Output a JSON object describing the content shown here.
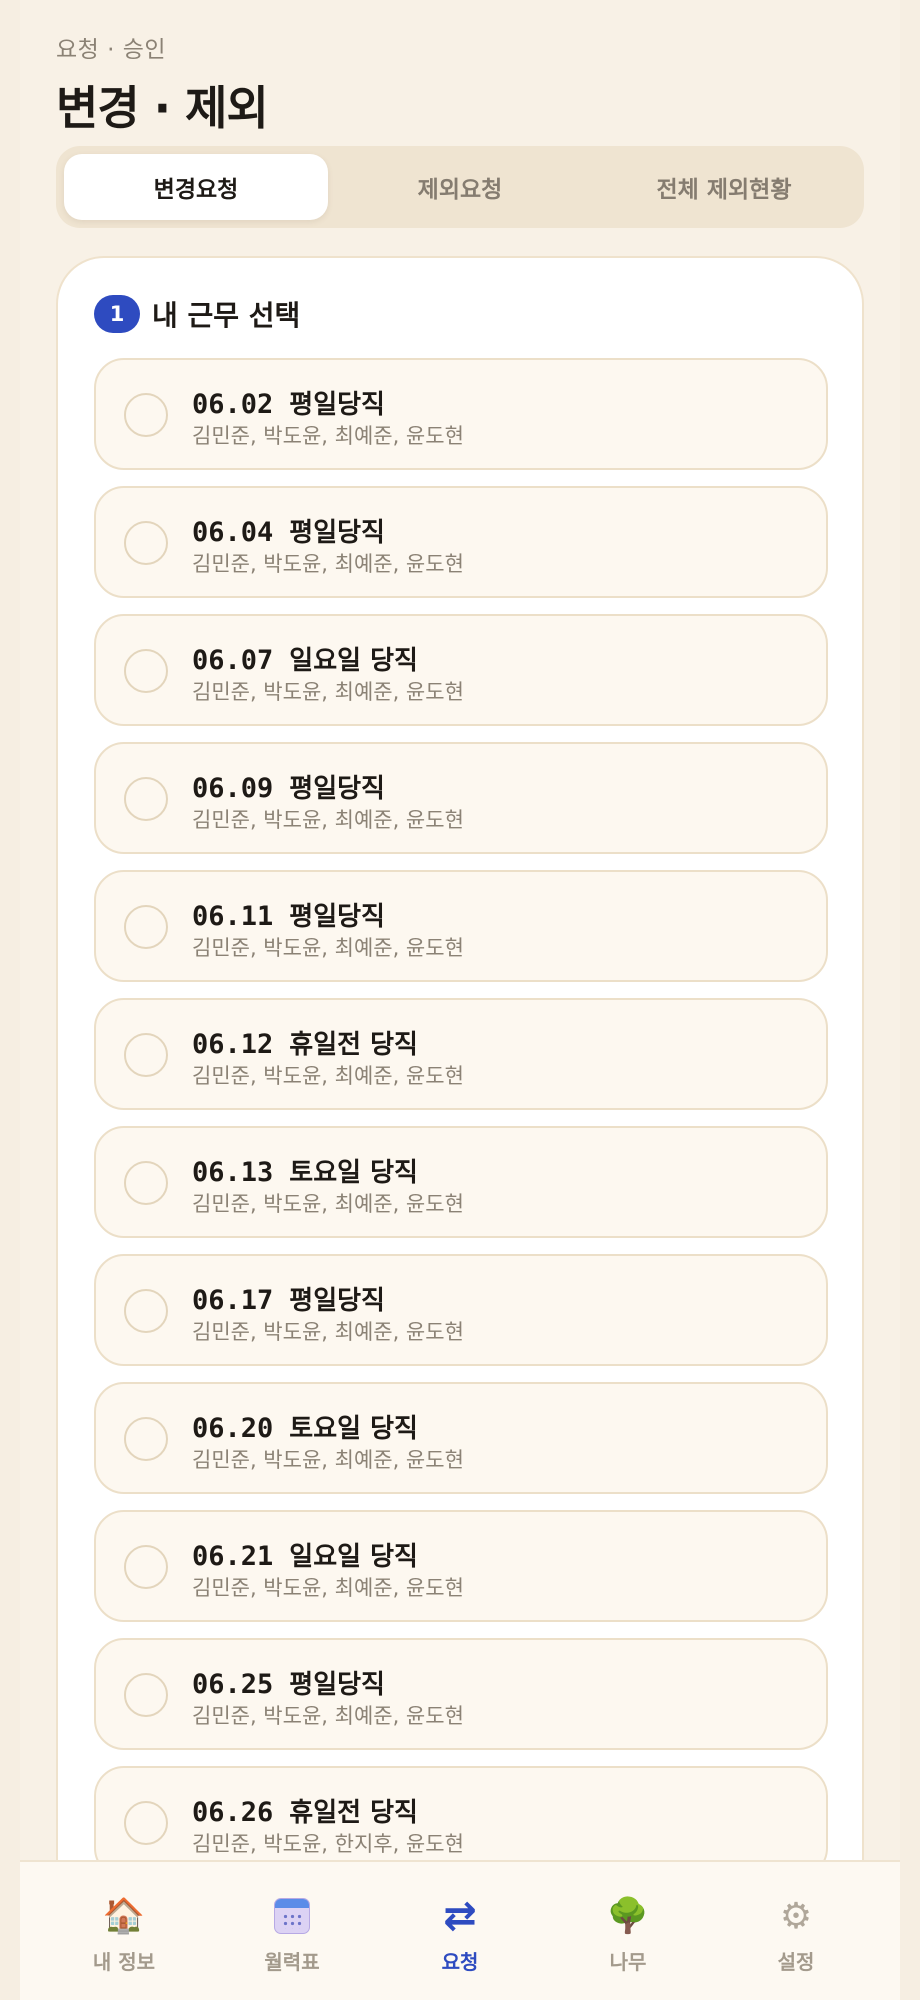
{
  "header": {
    "subtitle": "요청 · 승인",
    "title": "변경 · 제외"
  },
  "tabs": [
    {
      "label": "변경요청",
      "active": true
    },
    {
      "label": "제외요청",
      "active": false
    },
    {
      "label": "전체 제외현황",
      "active": false
    }
  ],
  "section": {
    "step": "1",
    "title": "내 근무 선택"
  },
  "shifts": [
    {
      "date": "06.02",
      "type": "평일당직",
      "members": "김민준, 박도윤, 최예준, 윤도현"
    },
    {
      "date": "06.04",
      "type": "평일당직",
      "members": "김민준, 박도윤, 최예준, 윤도현"
    },
    {
      "date": "06.07",
      "type": "일요일 당직",
      "members": "김민준, 박도윤, 최예준, 윤도현"
    },
    {
      "date": "06.09",
      "type": "평일당직",
      "members": "김민준, 박도윤, 최예준, 윤도현"
    },
    {
      "date": "06.11",
      "type": "평일당직",
      "members": "김민준, 박도윤, 최예준, 윤도현"
    },
    {
      "date": "06.12",
      "type": "휴일전 당직",
      "members": "김민준, 박도윤, 최예준, 윤도현"
    },
    {
      "date": "06.13",
      "type": "토요일 당직",
      "members": "김민준, 박도윤, 최예준, 윤도현"
    },
    {
      "date": "06.17",
      "type": "평일당직",
      "members": "김민준, 박도윤, 최예준, 윤도현"
    },
    {
      "date": "06.20",
      "type": "토요일 당직",
      "members": "김민준, 박도윤, 최예준, 윤도현"
    },
    {
      "date": "06.21",
      "type": "일요일 당직",
      "members": "김민준, 박도윤, 최예준, 윤도현"
    },
    {
      "date": "06.25",
      "type": "평일당직",
      "members": "김민준, 박도윤, 최예준, 윤도현"
    },
    {
      "date": "06.26",
      "type": "휴일전 당직",
      "members": "김민준, 박도윤, 한지후, 윤도현"
    }
  ],
  "nav": [
    {
      "label": "내 정보",
      "icon": "house-icon",
      "glyph": "🏠",
      "active": false
    },
    {
      "label": "월력표",
      "icon": "calendar-icon",
      "glyph": "",
      "active": false
    },
    {
      "label": "요청",
      "icon": "swap-arrows-icon",
      "glyph": "⇄",
      "active": true
    },
    {
      "label": "나무",
      "icon": "tree-icon",
      "glyph": "🌳",
      "active": false
    },
    {
      "label": "설정",
      "icon": "gear-icon",
      "glyph": "⚙",
      "active": false
    }
  ],
  "colors": {
    "accent": "#2e4bc0",
    "background": "#f8f1e6",
    "card": "#ffffff",
    "item": "#fdf8f0"
  }
}
